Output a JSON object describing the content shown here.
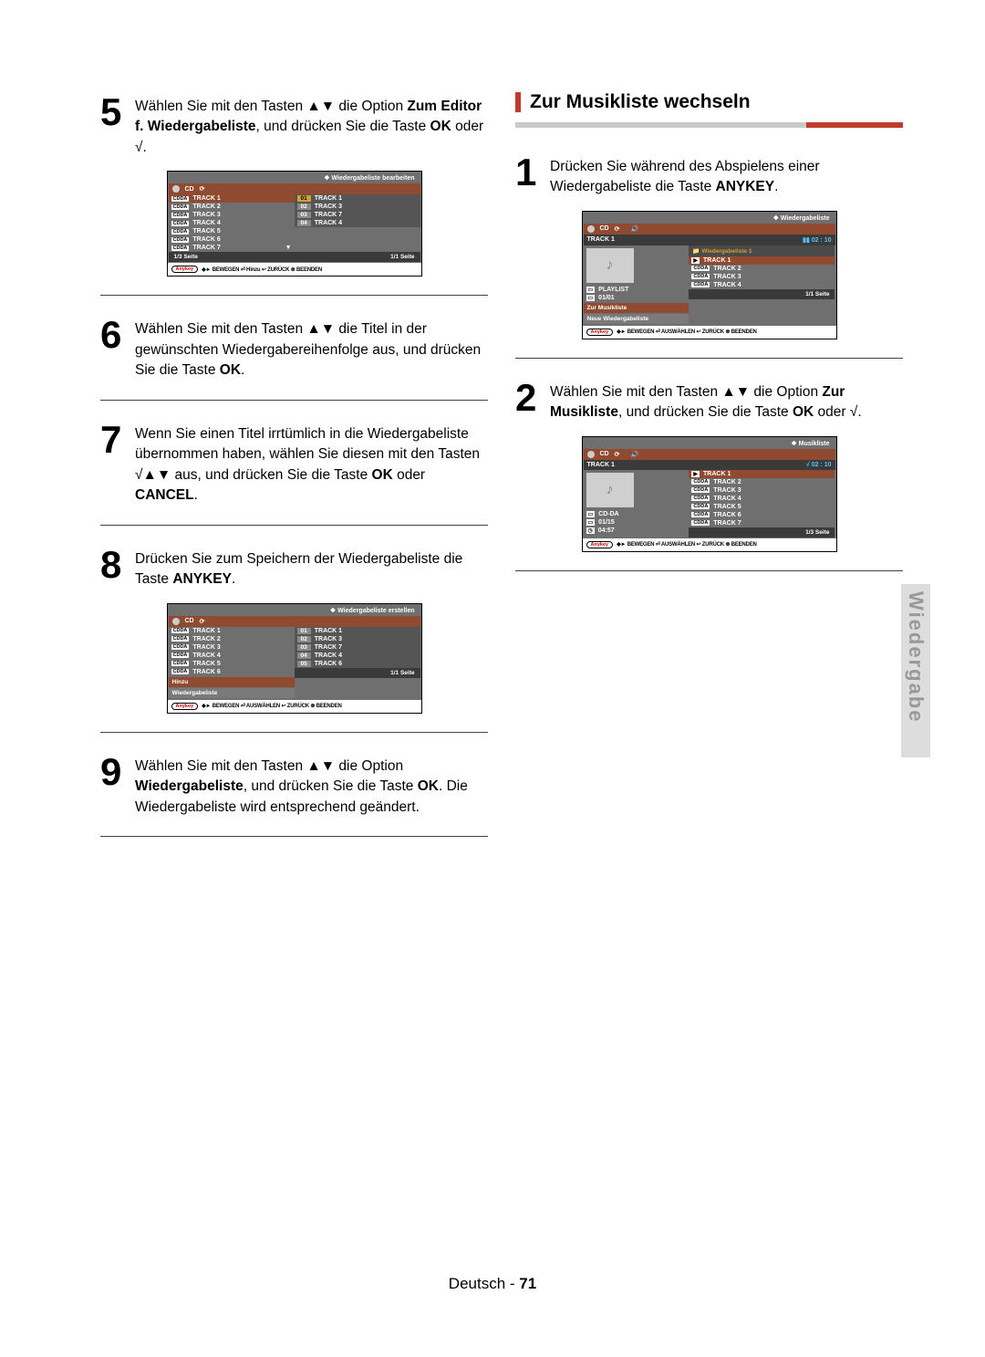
{
  "arrows": {
    "updown": "▲▼",
    "right": "√",
    "rightupdown": "√▲▼"
  },
  "left": {
    "step5": {
      "num": "5",
      "text_pre": "Wählen Sie mit den Tasten ",
      "arrows": "▲▼",
      "text_mid": " die Option ",
      "bold1": "Zum Editor f. Wiedergabeliste",
      "text_mid2": ", und drücken Sie die Taste ",
      "bold2": "OK",
      "text_end": " oder √."
    },
    "screen5": {
      "title": "Wiedergabeliste bearbeiten",
      "cd": "CD",
      "left_tracks": [
        "TRACK 1",
        "TRACK 2",
        "TRACK 3",
        "TRACK 4",
        "TRACK 5",
        "TRACK 6",
        "TRACK 7"
      ],
      "badge": "CDDA",
      "right_tracks": [
        {
          "n": "01",
          "t": "TRACK 1",
          "sel": true
        },
        {
          "n": "02",
          "t": "TRACK 3"
        },
        {
          "n": "03",
          "t": "TRACK 7"
        },
        {
          "n": "04",
          "t": "TRACK 4"
        }
      ],
      "page_left": "1/3 Seite",
      "page_right": "1/1 Seite",
      "legend": "◆► BEWEGEN   ⏎ Hinzu      ↩ ZURÜCK ⊗ BEENDEN",
      "anykey": "Anykey"
    },
    "step6": {
      "num": "6",
      "text_pre": "Wählen Sie mit den Tasten ",
      "arrows": "▲▼",
      "text_mid": " die Titel in der gewünschten Wiedergabereihenfolge aus, und drücken Sie die Taste ",
      "bold": "OK",
      "text_end": "."
    },
    "step7": {
      "num": "7",
      "text": "Wenn Sie einen Titel irrtümlich in die Wiedergabeliste übernommen haben, wählen Sie diesen mit den Tasten ",
      "arrows": "√▲▼",
      "text2": " aus, und drücken Sie die Taste ",
      "b1": "OK",
      "or": " oder ",
      "b2": "CANCEL",
      "end": "."
    },
    "step8": {
      "num": "8",
      "text": "Drücken Sie zum Speichern der Wiedergabeliste die Taste ",
      "bold": "ANYKEY",
      "end": "."
    },
    "screen8": {
      "title": "Wiedergabeliste erstellen",
      "cd": "CD",
      "left_tracks": [
        "TRACK 1",
        "TRACK 2",
        "TRACK 3",
        "TRACK 4",
        "TRACK 5",
        "TRACK 6"
      ],
      "hinzu": "Hinzu",
      "wiederg": "Wiedergabeliste",
      "badge": "CDDA",
      "right_tracks": [
        {
          "n": "01",
          "t": "TRACK 1"
        },
        {
          "n": "02",
          "t": "TRACK 3"
        },
        {
          "n": "03",
          "t": "TRACK 7"
        },
        {
          "n": "04",
          "t": "TRACK 4"
        },
        {
          "n": "05",
          "t": "TRACK 6"
        }
      ],
      "page_right": "1/1 Seite",
      "legend": "◆► BEWEGEN  ⏎ AUSWÄHLEN  ↩ ZURÜCK ⊗ BEENDEN",
      "anykey": "Anykey"
    },
    "step9": {
      "num": "9",
      "text_pre": "Wählen Sie mit den Tasten ",
      "arrows": "▲▼",
      "text_mid": " die Option ",
      "bold": "Wiedergabeliste",
      "text_mid2": ", und drücken Sie die Taste ",
      "bold2": "OK",
      "text_end": ". Die Wiedergabeliste wird entsprechend geändert."
    }
  },
  "right": {
    "heading": "Zur Musikliste wechseln",
    "step1": {
      "num": "1",
      "text": "Drücken Sie während des Abspielens einer Wiedergabeliste die Taste ",
      "bold": "ANYKEY",
      "end": "."
    },
    "screen1": {
      "title": "Wiedergabeliste",
      "cd": "CD",
      "now": "TRACK  1",
      "time": "▮▮ 02 : 10",
      "wglist": "Wiedergabeliste 1",
      "tracks": [
        "TRACK 1",
        "TRACK 2",
        "TRACK 3",
        "TRACK 4"
      ],
      "badge": "CDDA",
      "playlist_label": "PLAYLIST",
      "counter": "01/01",
      "menu_sel": "Zur Musikliste",
      "menu_other": "Neue Wiedergabeliste",
      "page": "1/1 Seite",
      "legend": "◆► BEWEGEN  ⏎ AUSWÄHLEN  ↩ ZURÜCK ⊗ BEENDEN",
      "anykey": "Anykey"
    },
    "step2": {
      "num": "2",
      "pre": "Wählen Sie mit den Tasten ",
      "arrows": "▲▼",
      "mid": " die Option ",
      "b1": "Zur Musikliste",
      "mid2": ", und drücken Sie die Taste ",
      "b2": "OK",
      "end": " oder √."
    },
    "screen2": {
      "title": "Musikliste",
      "cd": "CD",
      "now": "TRACK  1",
      "time": "√ 02 : 10",
      "tracks": [
        "TRACK 1",
        "TRACK 2",
        "TRACK 3",
        "TRACK 4",
        "TRACK 5",
        "TRACK 6",
        "TRACK 7"
      ],
      "badge": "CDDA",
      "cdda": "CD-DA",
      "counter": "01/15",
      "dur": "04:57",
      "page": "1/3 Seite",
      "legend": "◆► BEWEGEN  ⏎ AUSWÄHLEN  ↩ ZURÜCK ⊗ BEENDEN",
      "anykey": "Anykey"
    }
  },
  "sidetab": "Wiedergabe",
  "footer_lang": "Deutsch",
  "footer_sep": " - ",
  "footer_page": "71"
}
